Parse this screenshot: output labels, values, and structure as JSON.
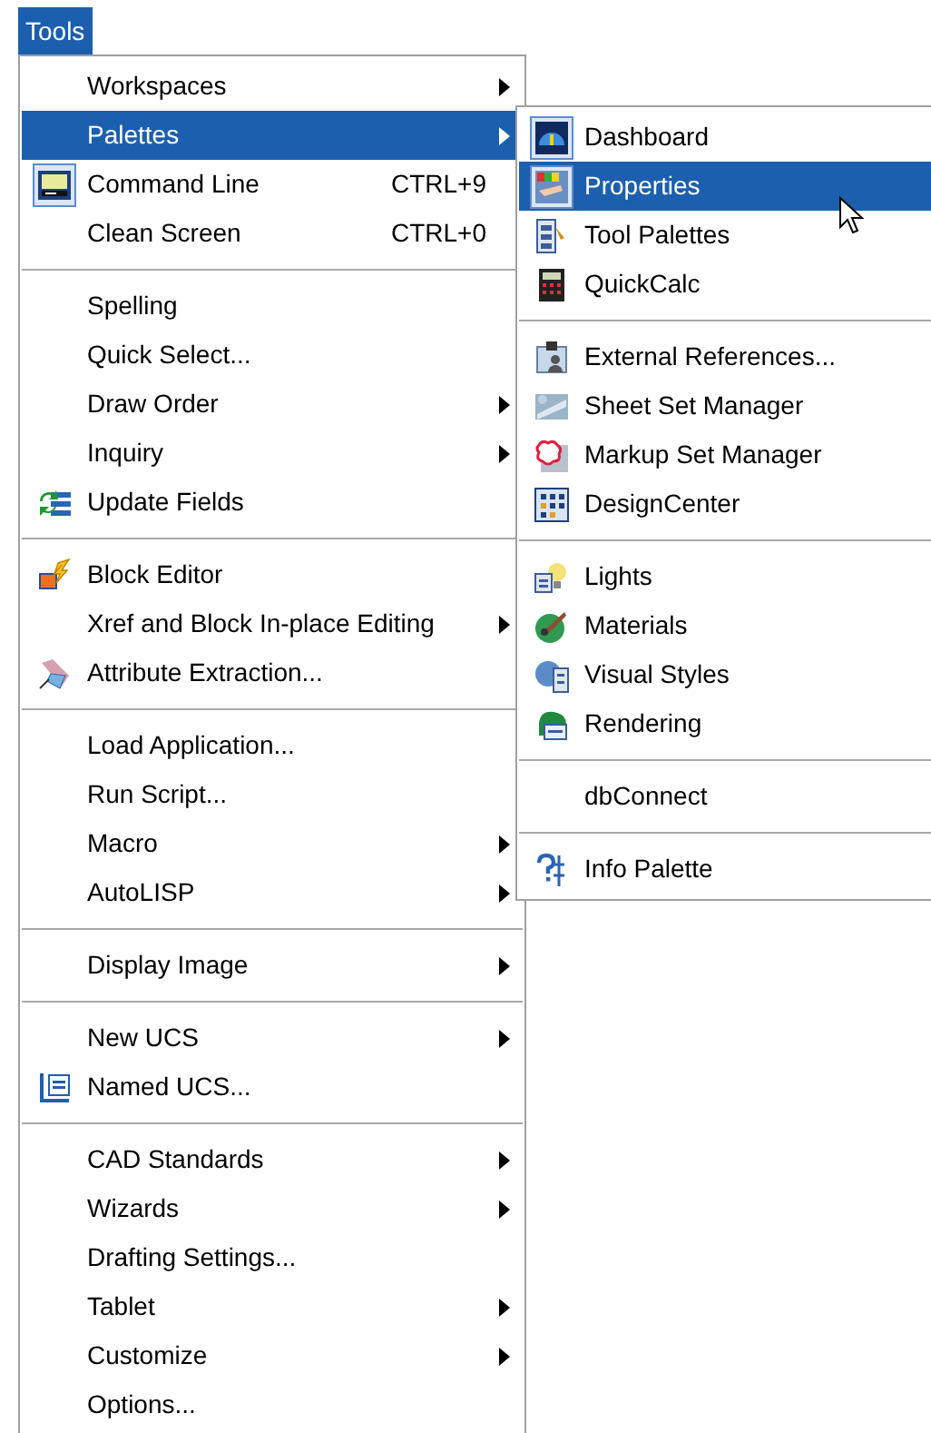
{
  "menu_bar": {
    "title": "Tools",
    "selected": true
  },
  "tools_menu": {
    "items": [
      {
        "kind": "item",
        "label": "Workspaces",
        "submenu": true,
        "selected": false,
        "checked": false
      },
      {
        "kind": "item",
        "label": "Palettes",
        "submenu": true,
        "selected": true,
        "checked": false
      },
      {
        "kind": "item",
        "label": "Command Line",
        "shortcut": "CTRL+9",
        "submenu": false,
        "selected": false,
        "checked": true
      },
      {
        "kind": "item",
        "label": "Clean Screen",
        "shortcut": "CTRL+0",
        "submenu": false,
        "selected": false,
        "checked": false
      },
      {
        "kind": "separator"
      },
      {
        "kind": "item",
        "label": "Spelling",
        "submenu": false,
        "selected": false,
        "checked": false
      },
      {
        "kind": "item",
        "label": "Quick Select...",
        "submenu": false,
        "selected": false,
        "checked": false
      },
      {
        "kind": "item",
        "label": "Draw Order",
        "submenu": true,
        "selected": false,
        "checked": false
      },
      {
        "kind": "item",
        "label": "Inquiry",
        "submenu": true,
        "selected": false,
        "checked": false
      },
      {
        "kind": "item",
        "label": "Update Fields",
        "submenu": false,
        "selected": false,
        "checked": false
      },
      {
        "kind": "separator"
      },
      {
        "kind": "item",
        "label": "Block Editor",
        "submenu": false,
        "selected": false,
        "checked": false
      },
      {
        "kind": "item",
        "label": "Xref and Block In-place Editing",
        "submenu": true,
        "selected": false,
        "checked": false
      },
      {
        "kind": "item",
        "label": "Attribute Extraction...",
        "submenu": false,
        "selected": false,
        "checked": false
      },
      {
        "kind": "separator"
      },
      {
        "kind": "item",
        "label": "Load Application...",
        "submenu": false,
        "selected": false,
        "checked": false
      },
      {
        "kind": "item",
        "label": "Run Script...",
        "submenu": false,
        "selected": false,
        "checked": false
      },
      {
        "kind": "item",
        "label": "Macro",
        "submenu": true,
        "selected": false,
        "checked": false
      },
      {
        "kind": "item",
        "label": "AutoLISP",
        "submenu": true,
        "selected": false,
        "checked": false
      },
      {
        "kind": "separator"
      },
      {
        "kind": "item",
        "label": "Display Image",
        "submenu": true,
        "selected": false,
        "checked": false
      },
      {
        "kind": "separator"
      },
      {
        "kind": "item",
        "label": "New UCS",
        "submenu": true,
        "selected": false,
        "checked": false
      },
      {
        "kind": "item",
        "label": "Named UCS...",
        "submenu": false,
        "selected": false,
        "checked": false
      },
      {
        "kind": "separator"
      },
      {
        "kind": "item",
        "label": "CAD Standards",
        "submenu": true,
        "selected": false,
        "checked": false
      },
      {
        "kind": "item",
        "label": "Wizards",
        "submenu": true,
        "selected": false,
        "checked": false
      },
      {
        "kind": "item",
        "label": "Drafting Settings...",
        "submenu": false,
        "selected": false,
        "checked": false
      },
      {
        "kind": "item",
        "label": "Tablet",
        "submenu": true,
        "selected": false,
        "checked": false
      },
      {
        "kind": "item",
        "label": "Customize",
        "submenu": true,
        "selected": false,
        "checked": false
      },
      {
        "kind": "item",
        "label": "Options...",
        "submenu": false,
        "selected": false,
        "checked": false
      }
    ]
  },
  "palettes_submenu": {
    "items": [
      {
        "kind": "item",
        "label": "Dashboard",
        "selected": false,
        "checked": true
      },
      {
        "kind": "item",
        "label": "Properties",
        "selected": true,
        "checked": true
      },
      {
        "kind": "item",
        "label": "Tool Palettes",
        "selected": false,
        "checked": false
      },
      {
        "kind": "item",
        "label": "QuickCalc",
        "selected": false,
        "checked": false
      },
      {
        "kind": "separator"
      },
      {
        "kind": "item",
        "label": "External References...",
        "selected": false,
        "checked": false
      },
      {
        "kind": "item",
        "label": "Sheet Set Manager",
        "selected": false,
        "checked": false
      },
      {
        "kind": "item",
        "label": "Markup Set Manager",
        "selected": false,
        "checked": false
      },
      {
        "kind": "item",
        "label": "DesignCenter",
        "selected": false,
        "checked": false
      },
      {
        "kind": "separator"
      },
      {
        "kind": "item",
        "label": "Lights",
        "selected": false,
        "checked": false
      },
      {
        "kind": "item",
        "label": "Materials",
        "selected": false,
        "checked": false
      },
      {
        "kind": "item",
        "label": "Visual Styles",
        "selected": false,
        "checked": false
      },
      {
        "kind": "item",
        "label": "Rendering",
        "selected": false,
        "checked": false
      },
      {
        "kind": "separator"
      },
      {
        "kind": "item",
        "label": "dbConnect",
        "selected": false,
        "checked": false
      },
      {
        "kind": "separator"
      },
      {
        "kind": "item",
        "label": "Info Palette",
        "selected": false,
        "checked": false
      }
    ]
  }
}
